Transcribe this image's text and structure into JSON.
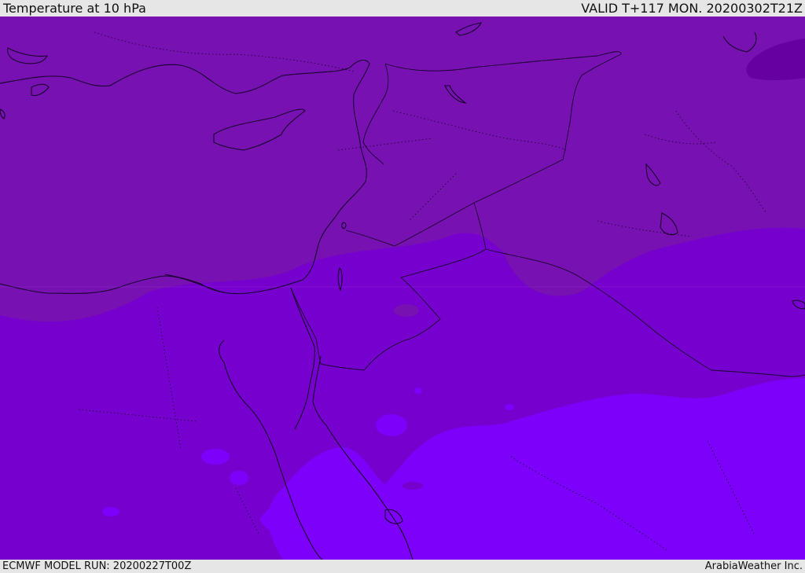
{
  "header": {
    "title": "Temperature at 10 hPa",
    "valid": "VALID T+117 MON. 20200302T21Z"
  },
  "footer": {
    "model_run": "ECMWF MODEL RUN: 20200227T00Z",
    "credit": "ArabiaWeather Inc."
  },
  "colors": {
    "band_dark": "#7711b1",
    "band_mid": "#7600cd",
    "band_light": "#7d00fb",
    "band_darkest": "#6600a0",
    "coast": "#1a0030"
  }
}
